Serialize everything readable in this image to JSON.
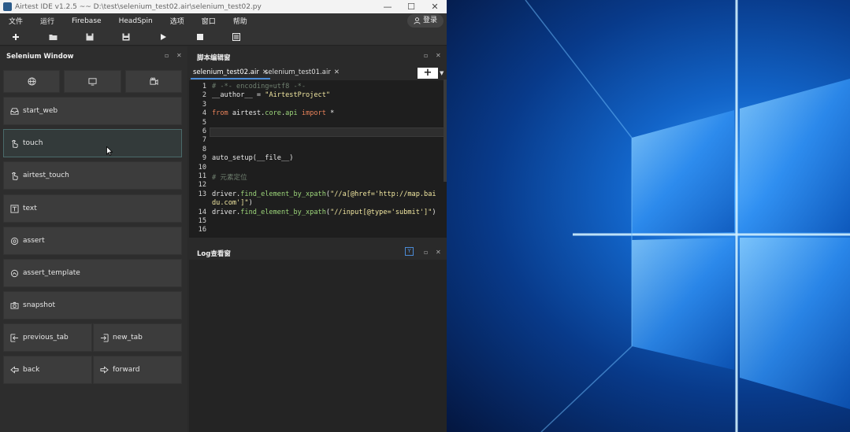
{
  "window": {
    "title": "Airtest IDE v1.2.5 ~~ D:\\test\\selenium_test02.air\\selenium_test02.py",
    "controls": [
      "—",
      "☐",
      "✕"
    ]
  },
  "menu": {
    "items": [
      "文件",
      "运行",
      "Firebase",
      "HeadSpin",
      "选项",
      "窗口",
      "帮助"
    ],
    "login": "登录"
  },
  "toolbar": {
    "icons": [
      "plus-icon",
      "folder-open-icon",
      "save-icon",
      "save-all-icon",
      "play-icon",
      "stop-icon",
      "log-icon"
    ]
  },
  "selenium_panel": {
    "title": "Selenium Window",
    "top_icons": [
      "globe-icon",
      "monitor-icon",
      "record-icon"
    ],
    "buttons": [
      {
        "label": "start_web",
        "icon": "tray-icon"
      },
      {
        "label": "touch",
        "icon": "hand-icon"
      },
      {
        "label": "airtest_touch",
        "icon": "hand-icon"
      },
      {
        "label": "text",
        "icon": "text-icon"
      },
      {
        "label": "assert",
        "icon": "target-icon"
      },
      {
        "label": "assert_template",
        "icon": "template-icon"
      },
      {
        "label": "snapshot",
        "icon": "camera-icon"
      }
    ],
    "pair_buttons": [
      {
        "left": "previous_tab",
        "right": "new_tab"
      },
      {
        "left": "back",
        "right": "forward"
      }
    ]
  },
  "editor": {
    "title": "脚本编辑窗",
    "tabs": [
      {
        "label": "selenium_test02.air",
        "active": true
      },
      {
        "label": "selenium_test01.air",
        "active": false
      }
    ],
    "add_label": "+",
    "lines": [
      {
        "n": "1",
        "parts": [
          {
            "t": "# -*- encoding=utf8 -*-",
            "c": "cm"
          }
        ]
      },
      {
        "n": "2",
        "parts": [
          {
            "t": "__author__ = ",
            "c": ""
          },
          {
            "t": "\"AirtestProject\"",
            "c": "str"
          }
        ]
      },
      {
        "n": "3",
        "parts": []
      },
      {
        "n": "4",
        "parts": [
          {
            "t": "from",
            "c": "kw"
          },
          {
            "t": " airtest.",
            "c": ""
          },
          {
            "t": "core",
            "c": "fn"
          },
          {
            "t": ".",
            "c": ""
          },
          {
            "t": "api",
            "c": "fn"
          },
          {
            "t": " ",
            "c": ""
          },
          {
            "t": "import",
            "c": "kw"
          },
          {
            "t": " *",
            "c": ""
          }
        ]
      },
      {
        "n": "5",
        "parts": []
      },
      {
        "n": "6",
        "parts": []
      },
      {
        "n": "7",
        "parts": []
      },
      {
        "n": "8",
        "parts": []
      },
      {
        "n": "9",
        "parts": [
          {
            "t": "auto_setup(__file__)",
            "c": ""
          }
        ]
      },
      {
        "n": "10",
        "parts": []
      },
      {
        "n": "11",
        "parts": [
          {
            "t": "# 元素定位",
            "c": "cm"
          }
        ]
      },
      {
        "n": "12",
        "parts": []
      },
      {
        "n": "13",
        "parts": [
          {
            "t": "driver.",
            "c": ""
          },
          {
            "t": "find_element_by_xpath",
            "c": "fn"
          },
          {
            "t": "(",
            "c": ""
          },
          {
            "t": "\"//a[@href='http://map.bai",
            "c": "str"
          }
        ]
      },
      {
        "n": "",
        "parts": [
          {
            "t": "du.com']\"",
            "c": "str"
          },
          {
            "t": ")",
            "c": ""
          }
        ]
      },
      {
        "n": "14",
        "parts": [
          {
            "t": "driver.",
            "c": ""
          },
          {
            "t": "find_element_by_xpath",
            "c": "fn"
          },
          {
            "t": "(",
            "c": ""
          },
          {
            "t": "\"//input[@type='submit']\"",
            "c": "str"
          },
          {
            "t": ")",
            "c": ""
          }
        ]
      },
      {
        "n": "15",
        "parts": []
      },
      {
        "n": "16",
        "parts": []
      }
    ]
  },
  "log_panel": {
    "title": "Log查看窗",
    "filter_label": "Y"
  },
  "colors": {
    "accent": "#4b8bd6",
    "string": "#f0e6a0",
    "keyword": "#e8825a",
    "function": "#9cd57a",
    "comment": "#6f7f6f"
  }
}
